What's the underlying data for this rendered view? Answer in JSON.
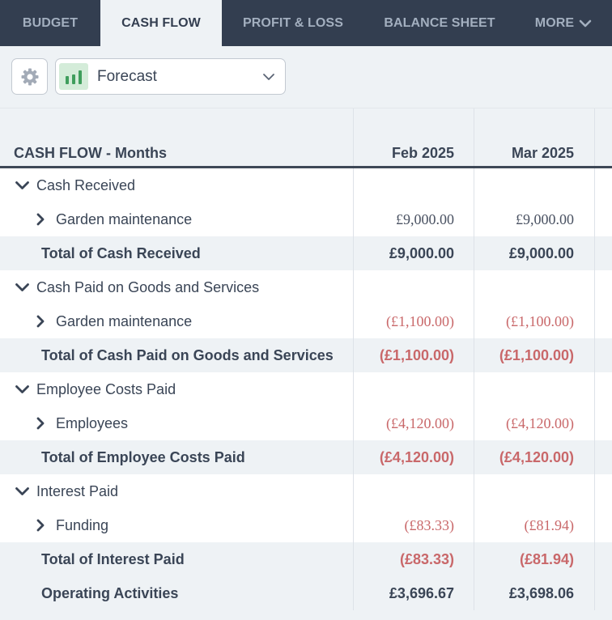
{
  "tabs": [
    {
      "label": "BUDGET",
      "active": false
    },
    {
      "label": "CASH FLOW",
      "active": true
    },
    {
      "label": "PROFIT & LOSS",
      "active": false
    },
    {
      "label": "BALANCE SHEET",
      "active": false
    },
    {
      "label": "MORE",
      "active": false
    }
  ],
  "toolbar": {
    "settings_icon": "gear-icon",
    "scenario_icon": "bar-chart-icon",
    "scenario_value": "Forecast"
  },
  "colors": {
    "nav_bg": "#333e50",
    "accent_green": "#3f9e5c",
    "negative": "#c9686a"
  },
  "table": {
    "header_label": "CASH FLOW - Months",
    "columns": [
      "Feb 2025",
      "Mar 2025"
    ],
    "rows": [
      {
        "type": "section",
        "label": "Cash Received",
        "values": [
          "",
          ""
        ]
      },
      {
        "type": "child",
        "label": "Garden maintenance",
        "values": [
          "£9,000.00",
          "£9,000.00"
        ],
        "negative": false
      },
      {
        "type": "total",
        "label": "Total of Cash Received",
        "values": [
          "£9,000.00",
          "£9,000.00"
        ],
        "negative": false
      },
      {
        "type": "section",
        "label": "Cash Paid on Goods and Services",
        "values": [
          "",
          ""
        ]
      },
      {
        "type": "child",
        "label": "Garden maintenance",
        "values": [
          "(£1,100.00)",
          "(£1,100.00)"
        ],
        "negative": true
      },
      {
        "type": "total",
        "label": "Total of Cash Paid on Goods and Services",
        "values": [
          "(£1,100.00)",
          "(£1,100.00)"
        ],
        "negative": true
      },
      {
        "type": "section",
        "label": "Employee Costs Paid",
        "values": [
          "",
          ""
        ]
      },
      {
        "type": "child",
        "label": "Employees",
        "values": [
          "(£4,120.00)",
          "(£4,120.00)"
        ],
        "negative": true
      },
      {
        "type": "total",
        "label": "Total of Employee Costs Paid",
        "values": [
          "(£4,120.00)",
          "(£4,120.00)"
        ],
        "negative": true
      },
      {
        "type": "section",
        "label": "Interest Paid",
        "values": [
          "",
          ""
        ]
      },
      {
        "type": "child",
        "label": "Funding",
        "values": [
          "(£83.33)",
          "(£81.94)"
        ],
        "negative": true
      },
      {
        "type": "total",
        "label": "Total of Interest Paid",
        "values": [
          "(£83.33)",
          "(£81.94)"
        ],
        "negative": true
      },
      {
        "type": "total",
        "label": "Operating Activities",
        "values": [
          "£3,696.67",
          "£3,698.06"
        ],
        "negative": false
      }
    ]
  }
}
